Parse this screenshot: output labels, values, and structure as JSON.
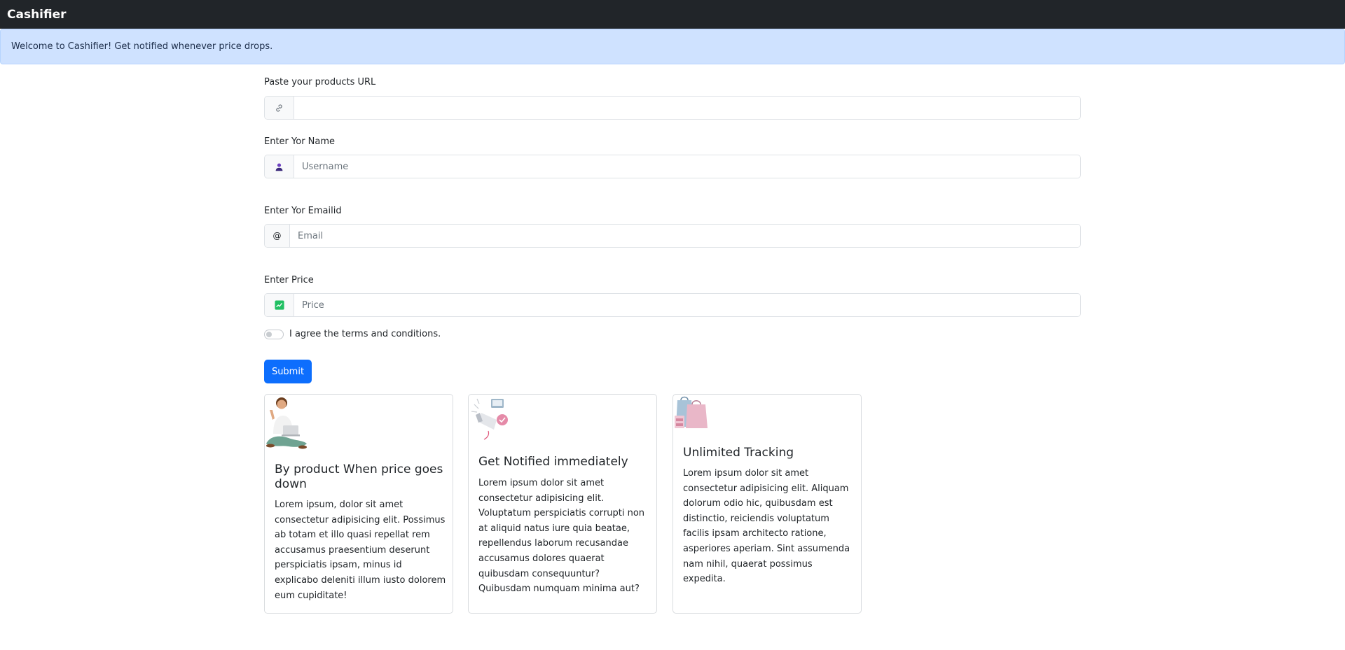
{
  "navbar": {
    "brand": "Cashifier"
  },
  "alert": {
    "message": "Welcome to Cashifier! Get notified whenever price drops."
  },
  "form": {
    "url": {
      "label": "Paste your products URL",
      "placeholder": "",
      "icon": "link-icon"
    },
    "name": {
      "label": "Enter Yor Name",
      "placeholder": "Username",
      "icon": "user-icon"
    },
    "email": {
      "label": "Enter Yor Emailid",
      "placeholder": "Email",
      "addon": "@"
    },
    "price": {
      "label": "Enter Price",
      "placeholder": "Price",
      "icon": "price-chart-icon"
    },
    "terms": {
      "label": "I agree the terms and conditions.",
      "checked": false
    },
    "submit_label": "Submit"
  },
  "cards": [
    {
      "title": "By product When price goes down",
      "text": "Lorem ipsum, dolor sit amet consectetur adipisicing elit. Possimus ab totam et illo quasi repellat rem accusamus praesentium deserunt perspiciatis ipsam, minus id explicabo deleniti illum iusto dolorem eum cupiditate!",
      "icon": "person-with-laptop-illustration"
    },
    {
      "title": "Get Notified immediately",
      "text": "Lorem ipsum dolor sit amet consectetur adipisicing elit. Voluptatum perspiciatis corrupti non at aliquid natus iure quia beatae, repellendus laborum recusandae accusamus dolores quaerat quibusdam consequuntur? Quibusdam numquam minima aut?",
      "icon": "megaphone-illustration"
    },
    {
      "title": "Unlimited Tracking",
      "text": "Lorem ipsum dolor sit amet consectetur adipisicing elit. Aliquam dolorum odio hic, quibusdam est distinctio, reiciendis voluptatum facilis ipsam architecto ratione, asperiores aperiam. Sint assumenda nam nihil, quaerat possimus expedita.",
      "icon": "shopping-bags-illustration"
    }
  ],
  "colors": {
    "navbar": "#212529",
    "alert_bg": "#cfe2ff",
    "primary": "#0d6efd"
  }
}
